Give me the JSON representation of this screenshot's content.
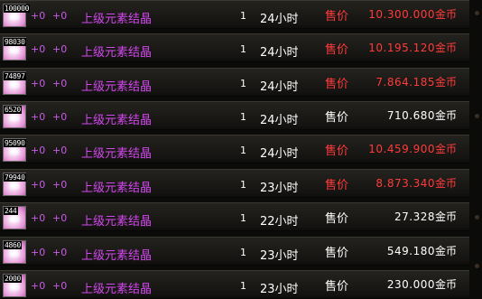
{
  "colors": {
    "name": "#d347ee",
    "plus": "#c85ce8",
    "price_red": "#ff3b3b",
    "price_white": "#ffffff"
  },
  "rows": [
    {
      "count": "100000",
      "plus1": "+0",
      "plus2": "+0",
      "name": "上级元素结晶",
      "qty": "1",
      "duration": "24小时",
      "price_label": "售价",
      "price": "10.300.000",
      "currency": "金币",
      "price_color": "#ff3b3b"
    },
    {
      "count": "98030",
      "plus1": "+0",
      "plus2": "+0",
      "name": "上级元素结晶",
      "qty": "1",
      "duration": "24小时",
      "price_label": "售价",
      "price": "10.195.120",
      "currency": "金币",
      "price_color": "#ff3b3b"
    },
    {
      "count": "74897",
      "plus1": "+0",
      "plus2": "+0",
      "name": "上级元素结晶",
      "qty": "1",
      "duration": "24小时",
      "price_label": "售价",
      "price": "7.864.185",
      "currency": "金币",
      "price_color": "#ff3b3b"
    },
    {
      "count": "6520",
      "plus1": "+0",
      "plus2": "+0",
      "name": "上级元素结晶",
      "qty": "1",
      "duration": "24小时",
      "price_label": "售价",
      "price": "710.680",
      "currency": "金币",
      "price_color": "#ffffff"
    },
    {
      "count": "95090",
      "plus1": "+0",
      "plus2": "+0",
      "name": "上级元素结晶",
      "qty": "1",
      "duration": "24小时",
      "price_label": "售价",
      "price": "10.459.900",
      "currency": "金币",
      "price_color": "#ff3b3b"
    },
    {
      "count": "79940",
      "plus1": "+0",
      "plus2": "+0",
      "name": "上级元素结晶",
      "qty": "1",
      "duration": "23小时",
      "price_label": "售价",
      "price": "8.873.340",
      "currency": "金币",
      "price_color": "#ff3b3b"
    },
    {
      "count": "244",
      "plus1": "+0",
      "plus2": "+0",
      "name": "上级元素结晶",
      "qty": "1",
      "duration": "22小时",
      "price_label": "售价",
      "price": "27.328",
      "currency": "金币",
      "price_color": "#ffffff"
    },
    {
      "count": "4860",
      "plus1": "+0",
      "plus2": "+0",
      "name": "上级元素结晶",
      "qty": "1",
      "duration": "23小时",
      "price_label": "售价",
      "price": "549.180",
      "currency": "金币",
      "price_color": "#ffffff"
    },
    {
      "count": "2000",
      "plus1": "+0",
      "plus2": "+0",
      "name": "上级元素结晶",
      "qty": "1",
      "duration": "23小时",
      "price_label": "售价",
      "price": "230.000",
      "currency": "金币",
      "price_color": "#ffffff"
    }
  ]
}
